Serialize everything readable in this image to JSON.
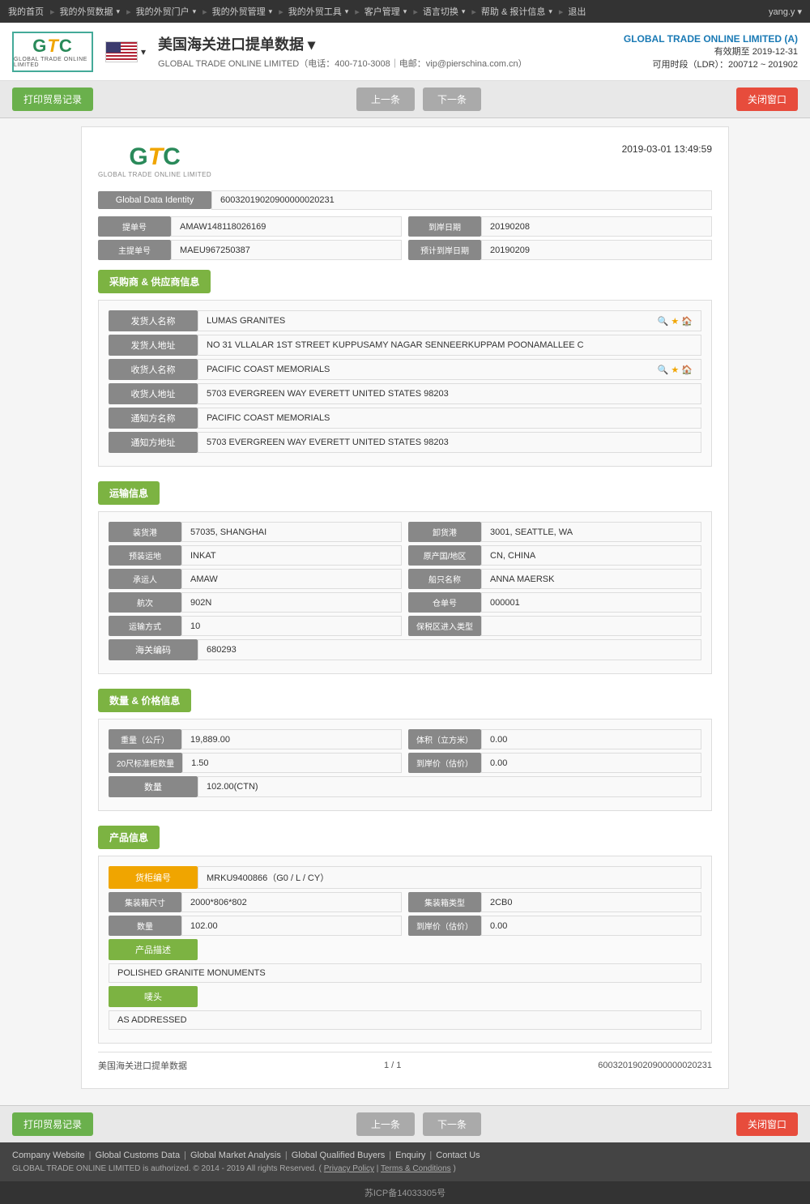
{
  "nav": {
    "items": [
      {
        "label": "我的首页",
        "hasDropdown": false
      },
      {
        "label": "我的外贸数据",
        "hasDropdown": true
      },
      {
        "label": "我的外贸门户",
        "hasDropdown": true
      },
      {
        "label": "我的外贸管理",
        "hasDropdown": true
      },
      {
        "label": "我的外贸工具",
        "hasDropdown": true
      },
      {
        "label": "客户管理",
        "hasDropdown": true
      },
      {
        "label": "语言切换",
        "hasDropdown": true
      },
      {
        "label": "帮助 & 报计信息",
        "hasDropdown": true
      },
      {
        "label": "退出",
        "hasDropdown": false
      }
    ],
    "user": "yang.y ▾"
  },
  "header": {
    "logo_text": "GTO",
    "logo_sub": "GLOBAL TRADE ONLINE LIMITED",
    "flag_alt": "USA Flag",
    "title": "美国海关进口提单数据 ▾",
    "subtitle_company": "GLOBAL TRADE ONLINE LIMITED",
    "subtitle_phone": "电话：400-710-3008",
    "subtitle_email": "电邮：vip@pierschina.com.cn",
    "company_name": "GLOBAL TRADE ONLINE LIMITED (A)",
    "validity": "有效期至 2019-12-31",
    "ldr": "可用时段（LDR）：200712 ~ 201902"
  },
  "toolbar": {
    "print_btn": "打印贸易记录",
    "prev_btn": "上一条",
    "next_btn": "下一条",
    "close_btn": "关闭窗口"
  },
  "doc": {
    "logo_gto": "GTO",
    "logo_sub": "GLOBAL TRADE ONLINE LIMITED",
    "timestamp": "2019-03-01 13:49:59",
    "global_data_identity_label": "Global Data Identity",
    "global_data_identity_value": "60032019020900000020231",
    "fields": {
      "bill_no_label": "提单号",
      "bill_no_value": "AMAW148118026169",
      "arrival_date_label": "到岸日期",
      "arrival_date_value": "20190208",
      "master_bill_label": "主提单号",
      "master_bill_value": "MAEU967250387",
      "estimated_arrival_label": "预计到岸日期",
      "estimated_arrival_value": "20190209"
    }
  },
  "section_buyer_supplier": {
    "title": "采购商 & 供应商信息",
    "shipper_name_label": "发货人名称",
    "shipper_name_value": "LUMAS GRANITES",
    "shipper_address_label": "发货人地址",
    "shipper_address_value": "NO 31 VLLALAR 1ST STREET KUPPUSAMY NAGAR SENNEERKUPPAM POONAMALLEE C",
    "consignee_name_label": "收货人名称",
    "consignee_name_value": "PACIFIC COAST MEMORIALS",
    "consignee_address_label": "收货人地址",
    "consignee_address_value": "5703 EVERGREEN WAY EVERETT UNITED STATES 98203",
    "notify_name_label": "通知方名称",
    "notify_name_value": "PACIFIC COAST MEMORIALS",
    "notify_address_label": "通知方地址",
    "notify_address_value": "5703 EVERGREEN WAY EVERETT UNITED STATES 98203"
  },
  "section_transport": {
    "title": "运输信息",
    "load_port_label": "装货港",
    "load_port_value": "57035, SHANGHAI",
    "discharge_port_label": "卸货港",
    "discharge_port_value": "3001, SEATTLE, WA",
    "pre_transport_label": "预装运地",
    "pre_transport_value": "INKAT",
    "origin_label": "原产国/地区",
    "origin_value": "CN, CHINA",
    "carrier_label": "承运人",
    "carrier_value": "AMAW",
    "vessel_label": "船只名称",
    "vessel_value": "ANNA MAERSK",
    "voyage_label": "航次",
    "voyage_value": "902N",
    "warehouse_no_label": "仓单号",
    "warehouse_no_value": "000001",
    "transport_mode_label": "运输方式",
    "transport_mode_value": "10",
    "bonded_type_label": "保税区进入类型",
    "bonded_type_value": "",
    "customs_code_label": "海关编码",
    "customs_code_value": "680293"
  },
  "section_quantity_price": {
    "title": "数量 & 价格信息",
    "weight_label": "重量（公斤）",
    "weight_value": "19,889.00",
    "volume_label": "体积（立方米）",
    "volume_value": "0.00",
    "twenty_ft_label": "20尺标准柜数量",
    "twenty_ft_value": "1.50",
    "arrival_price_label": "到岸价（估价）",
    "arrival_price_value": "0.00",
    "quantity_label": "数量",
    "quantity_value": "102.00(CTN)"
  },
  "section_product": {
    "title": "产品信息",
    "container_no_label": "货柜编号",
    "container_no_value": "MRKU9400866（G0 / L / CY）",
    "container_size_label": "集装箱尺寸",
    "container_size_value": "2000*806*802",
    "container_type_label": "集装箱类型",
    "container_type_value": "2CB0",
    "quantity_label": "数量",
    "quantity_value": "102.00",
    "arrival_price_label": "到岸价（估价）",
    "arrival_price_value": "0.00",
    "description_label": "产品描述",
    "description_value": "POLISHED GRANITE MONUMENTS",
    "marks_label": "唛头",
    "marks_value": "AS ADDRESSED"
  },
  "doc_footer": {
    "left": "美国海关进口提单数据",
    "center": "1 / 1",
    "right": "60032019020900000020231"
  },
  "footer": {
    "links": [
      {
        "label": "Company Website"
      },
      {
        "label": "Global Customs Data"
      },
      {
        "label": "Global Market Analysis"
      },
      {
        "label": "Global Qualified Buyers"
      },
      {
        "label": "Enquiry"
      },
      {
        "label": "Contact Us"
      }
    ],
    "copyright": "GLOBAL TRADE ONLINE LIMITED is authorized. © 2014 - 2019 All rights Reserved.",
    "privacy": "Privacy Policy",
    "terms": "Terms & Conditions",
    "icp": "苏ICP备14033305号"
  }
}
